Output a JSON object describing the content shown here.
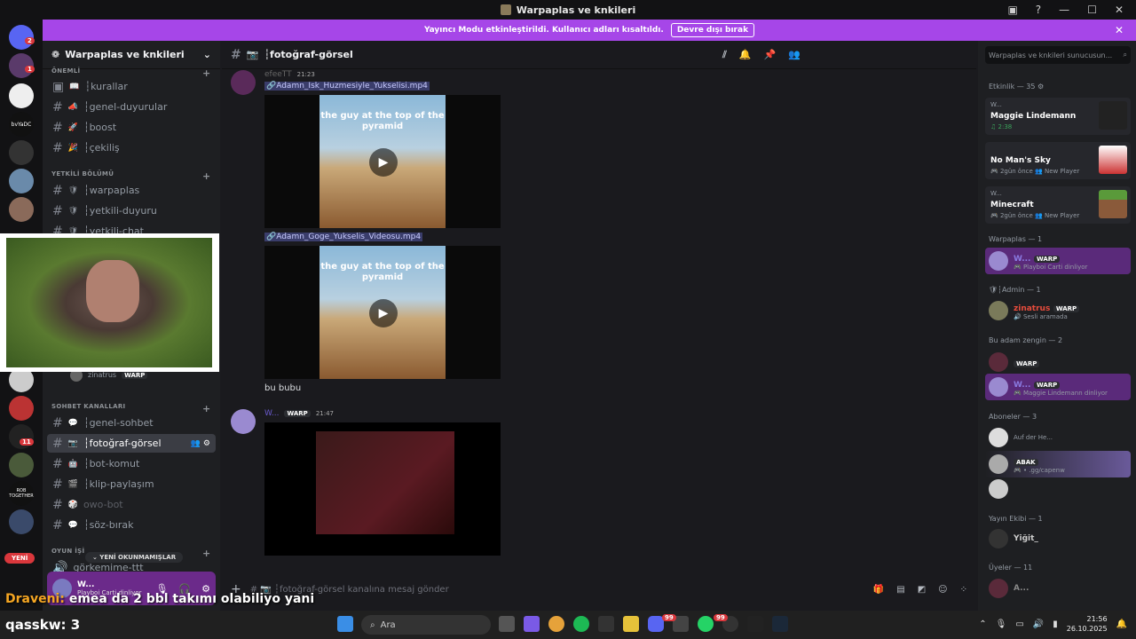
{
  "window": {
    "title": "Warpaplas ve knkileri",
    "controls": [
      "▣",
      "?",
      "—",
      "☐",
      "✕"
    ]
  },
  "banner": {
    "text": "Yayıncı Modu etkinleştirildi. Kullanıcı adları kısaltıldı.",
    "button": "Devre dışı bırak",
    "close": "✕"
  },
  "guilds": {
    "badges": [
      "2",
      "1",
      "11"
    ],
    "labels": [
      "bvYaDC",
      "ROB TOGETHER"
    ]
  },
  "server": {
    "name": "Warpaplas ve knkileri"
  },
  "categories": [
    {
      "name": "ÖNEMLİ"
    },
    {
      "name": "YETKİLİ BÖLÜMÜ"
    },
    {
      "name": "SOHBET KANALLARI"
    },
    {
      "name": "OYUN İŞİ"
    }
  ],
  "channels": [
    {
      "emoji": "📖",
      "name": "┆kurallar"
    },
    {
      "emoji": "📣",
      "name": "┆genel-duyurular"
    },
    {
      "emoji": "🚀",
      "name": "┆boost"
    },
    {
      "emoji": "🎉",
      "name": "┆çekiliş"
    },
    {
      "emoji": "🛡",
      "name": "┆warpaplas"
    },
    {
      "emoji": "🛡",
      "name": "┆yetkili-duyuru"
    },
    {
      "emoji": "🛡",
      "name": "┆yetkili-chat"
    },
    {
      "emoji": "💬",
      "name": "┆genel-sohbet"
    },
    {
      "emoji": "📷",
      "name": "┆fotoğraf-görsel"
    },
    {
      "emoji": "🤖",
      "name": "┆bot-komut"
    },
    {
      "emoji": "🎬",
      "name": "┆klip-paylaşım"
    },
    {
      "emoji": "🎲",
      "name": "owo-bot"
    },
    {
      "emoji": "💬",
      "name": "┆söz-bırak"
    }
  ],
  "voice": {
    "name": "görkemime-ttt",
    "member": "zinatrus",
    "tag": "WARP"
  },
  "pills": {
    "new": "YENİ",
    "unread": "⌄ YENİ OKUNMAMIŞLAR"
  },
  "user": {
    "name": "W...",
    "status": "Playboi Carti dinliyor"
  },
  "channel_header": {
    "name": "┆fotoğraf-görsel",
    "icon": "📷"
  },
  "messages": [
    {
      "author": "efeeTT",
      "time": "21:23",
      "attachments": [
        "Adamn_Isk_Huzmesiyle_Yukselisi.mp4",
        "Adamn_Goge_Yukselis_Videosu.mp4"
      ],
      "video_caption": "the guy at the top of the pyramid",
      "text": "bu bubu"
    },
    {
      "author": "W...",
      "tag": "WARP",
      "time": "21:47"
    }
  ],
  "composer": {
    "placeholder": "# 📷 ┆fotoğraf-görsel kanalına mesaj gönder"
  },
  "members": {
    "search": "Warpaplas ve knkileri sunucusun...",
    "activity_header": "Etkinlik — 35 ⚙",
    "activities": [
      {
        "small": "W...",
        "name": "Maggie Lindemann",
        "sub": "♫ 2:38"
      },
      {
        "small": "",
        "name": "No Man's Sky",
        "sub": "🎮 2gün önce  👥 New Player"
      },
      {
        "small": "W...",
        "name": "Minecraft",
        "sub": "🎮 2gün önce  👥 New Player"
      }
    ],
    "groups": [
      {
        "title": "Warpaplas — 1",
        "items": [
          {
            "name": "W...",
            "tag": "WARP",
            "status": "🎮 Playboi Carti dinliyor"
          }
        ]
      },
      {
        "title": "🛡┆Admin — 1",
        "items": [
          {
            "name": "zinatrus",
            "tag": "WARP",
            "status": "🔊 Sesli aramada"
          }
        ]
      },
      {
        "title": "Bu adam zengin — 2",
        "items": [
          {
            "name": "",
            "tag": "WARP",
            "status": ""
          },
          {
            "name": "W...",
            "tag": "WARP",
            "status": "🎮 Maggie Lindemann dinliyor"
          }
        ]
      },
      {
        "title": "Aboneler — 3",
        "items": [
          {
            "name": "",
            "tag": "",
            "status": "Auf der He..."
          },
          {
            "name": "",
            "tag": "ABAK",
            "status": "🎮 • .gg/capenw"
          },
          {
            "name": "",
            "tag": "",
            "status": ""
          }
        ]
      },
      {
        "title": "Yayın Ekibi — 1",
        "items": [
          {
            "name": "Yiğit_",
            "tag": "",
            "status": ""
          }
        ]
      },
      {
        "title": "Üyeler — 11",
        "items": [
          {
            "name": "A...",
            "tag": "",
            "status": ""
          }
        ]
      }
    ]
  },
  "overlay": {
    "chat_user": "Draveni:",
    "chat_text": "emea da 2 bbl takımı olabiliyo yani",
    "bottom_user": "qasskw:",
    "bottom_value": "3"
  },
  "taskbar": {
    "search": "Ara",
    "time": "21:56",
    "date": "26.10.2025",
    "discord_badge": "99",
    "whatsapp_badge": "99"
  }
}
